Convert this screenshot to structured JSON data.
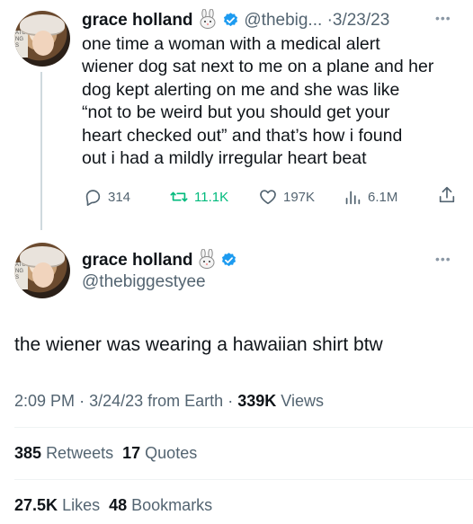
{
  "reply_tweet": {
    "display_name": "grace holland",
    "handle_truncated": "@thebig...",
    "separator": "·",
    "date": "3/23/23",
    "text_lines": [
      "one time a woman with a medical alert",
      "wiener dog sat next to me on a plane and her",
      "dog kept alerting on me and she was like",
      "“not to be weird but you should get your",
      "heart checked out” and that’s how i found",
      "out i had a mildly irregular heart beat"
    ],
    "actions": {
      "replies": "314",
      "retweets": "11.1K",
      "likes": "197K",
      "views": "6.1M"
    },
    "more_label": "•••"
  },
  "main_tweet": {
    "display_name": "grace holland",
    "handle": "@thebiggestyee",
    "more_label": "•••",
    "text": "the wiener was wearing a hawaiian shirt btw",
    "time": "2:09 PM",
    "dot": "·",
    "date": "3/24/23",
    "source": "from Earth",
    "views_count": "339K",
    "views_label": "Views",
    "retweets_count": "385",
    "retweets_label": "Retweets",
    "quotes_count": "17",
    "quotes_label": "Quotes",
    "likes_count": "27.5K",
    "likes_label": "Likes",
    "bookmarks_count": "48",
    "bookmarks_label": "Bookmarks"
  },
  "avatar_sign_text": "ATU NG S",
  "colors": {
    "verified_blue": "#1d9bf0",
    "text_primary": "#0f1419",
    "text_secondary": "#536471",
    "thread_line": "#cfd9de"
  },
  "icons": [
    "bunny-emoji-icon",
    "verified-badge-icon",
    "more-icon",
    "reply-icon",
    "retweet-icon",
    "like-icon",
    "views-icon",
    "share-icon"
  ]
}
